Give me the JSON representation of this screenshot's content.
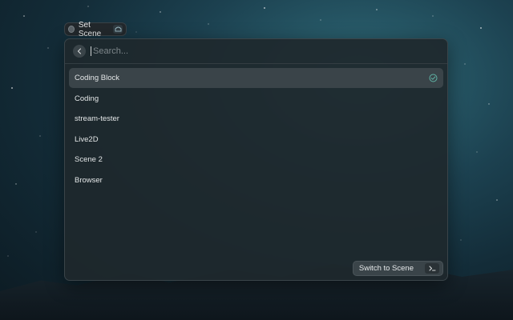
{
  "header": {
    "title": "Set Scene"
  },
  "search": {
    "placeholder": "Search..."
  },
  "scenes": [
    {
      "label": "Coding Block",
      "active": true
    },
    {
      "label": "Coding",
      "active": false
    },
    {
      "label": "stream-tester",
      "active": false
    },
    {
      "label": "Live2D",
      "active": false
    },
    {
      "label": "Scene 2",
      "active": false
    },
    {
      "label": "Browser",
      "active": false
    }
  ],
  "footer": {
    "action_label": "Switch to Scene",
    "shortcut": "↵"
  },
  "colors": {
    "accent_check": "#5fb3a5"
  },
  "icons": {
    "back": "chevron-left-icon",
    "active": "check-circle-icon",
    "extension": "extension-icon"
  }
}
